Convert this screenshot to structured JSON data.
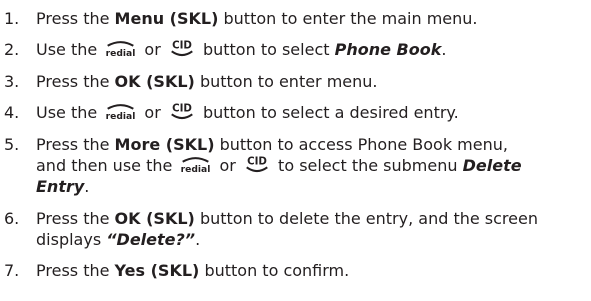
{
  "steps": [
    {
      "number": "1.",
      "t1": "Press the ",
      "b1": "Menu (SKL)",
      "t2": " button to enter the main menu."
    },
    {
      "number": "2.",
      "t1": "Use the ",
      "or": " or ",
      "t2": " button to select ",
      "bi1": "Phone Book",
      "t3": "."
    },
    {
      "number": "3.",
      "t1": "Press the ",
      "b1": "OK (SKL)",
      "t2": " button to enter menu."
    },
    {
      "number": "4.",
      "t1": "Use the ",
      "or": " or ",
      "t2": " button to select a desired entry."
    },
    {
      "number": "5.",
      "t1": "Press the ",
      "b1": "More (SKL)",
      "t2": " button to access Phone Book menu,",
      "t3": "and then use the ",
      "or": " or ",
      "t4": " to select the submenu ",
      "bi1": "Delete",
      "bi2": "Entry",
      "t5": "."
    },
    {
      "number": "6.",
      "t1": "Press the ",
      "b1": "OK (SKL)",
      "t2": " button to delete the entry, and the screen",
      "t3": "displays ",
      "q1": "“Delete?”",
      "t4": "."
    },
    {
      "number": "7.",
      "t1": "Press the ",
      "b1": "Yes (SKL)",
      "t2": " button to confirm."
    }
  ],
  "icons": {
    "redial": "redial-key-icon",
    "cid": "cid-key-icon"
  },
  "colors": {
    "text": "#231f20"
  }
}
